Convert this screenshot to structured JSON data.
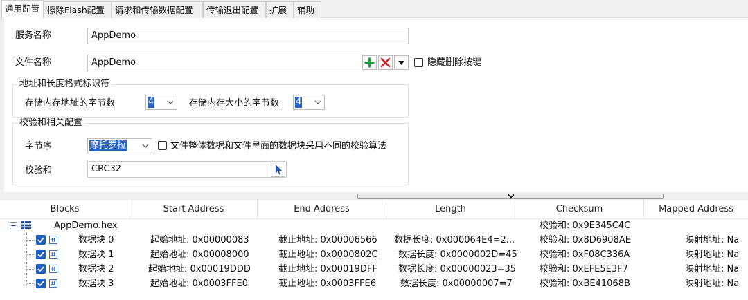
{
  "tabs": [
    {
      "label": "通用配置",
      "active": true
    },
    {
      "label": "擦除Flash配置"
    },
    {
      "label": "请求和传输数据配置"
    },
    {
      "label": "传输退出配置"
    },
    {
      "label": "扩展"
    },
    {
      "label": "辅助"
    }
  ],
  "general": {
    "service_name_label": "服务名称",
    "service_name_value": "AppDemo",
    "file_name_label": "文件名称",
    "file_name_value": "AppDemo",
    "hide_delete_label": "隐藏删除按键",
    "hide_delete_checked": false
  },
  "addr_group": {
    "legend": "地址和长度格式标识符",
    "addr_bytes_label": "存储内存地址的字节数",
    "addr_bytes_value": "4",
    "size_bytes_label": "存储内存大小的字节数",
    "size_bytes_value": "4"
  },
  "checksum_group": {
    "legend": "校验和相关配置",
    "byte_order_label": "字节序",
    "byte_order_value": "摩托罗拉",
    "diff_algo_label": "文件整体数据和文件里面的数据块采用不同的校验算法",
    "diff_algo_checked": false,
    "checksum_label": "校验和",
    "checksum_value": "CRC32"
  },
  "table": {
    "columns": [
      "Blocks",
      "Start Address",
      "End Address",
      "Length",
      "Checksum",
      "Mapped Address"
    ],
    "root": {
      "name": "AppDemo.hex",
      "checksum": "校验和: 0x9E345C4C"
    },
    "rows": [
      {
        "name": "数据块 0",
        "start": "起始地址: 0x00000083",
        "end": "截止地址: 0x00006566",
        "length": "数据长度: 0x000064E4=2...",
        "checksum": "校验和: 0x8D6908AE",
        "mapped": "映射地址: Na"
      },
      {
        "name": "数据块 1",
        "start": "起始地址: 0x00008000",
        "end": "截止地址: 0x0000802C",
        "length": "数据长度: 0x0000002D=45",
        "checksum": "校验和: 0xF08C336A",
        "mapped": "映射地址: Na"
      },
      {
        "name": "数据块 2",
        "start": "起始地址: 0x00019DDD",
        "end": "截止地址: 0x00019DFF",
        "length": "数据长度: 0x00000023=35",
        "checksum": "校验和: 0xEFE5E3F7",
        "mapped": "映射地址: Na"
      },
      {
        "name": "数据块 3",
        "start": "起始地址: 0x0003FFE0",
        "end": "截止地址: 0x0003FFE6",
        "length": "数据长度: 0x00000007=7",
        "checksum": "校验和: 0xBE41068B",
        "mapped": "映射地址: Na"
      }
    ]
  },
  "colors": {
    "accent": "#2b63c9",
    "checkbox": "#1f5fbf",
    "add": "#1a9e3a",
    "delete": "#d42020"
  },
  "icons": [
    "plus-icon",
    "delete-icon",
    "dropdown-arrow-icon",
    "cursor-arrow-icon",
    "collapse-icon",
    "grid-icon",
    "hex-file-icon",
    "checkbox-checked-icon"
  ]
}
